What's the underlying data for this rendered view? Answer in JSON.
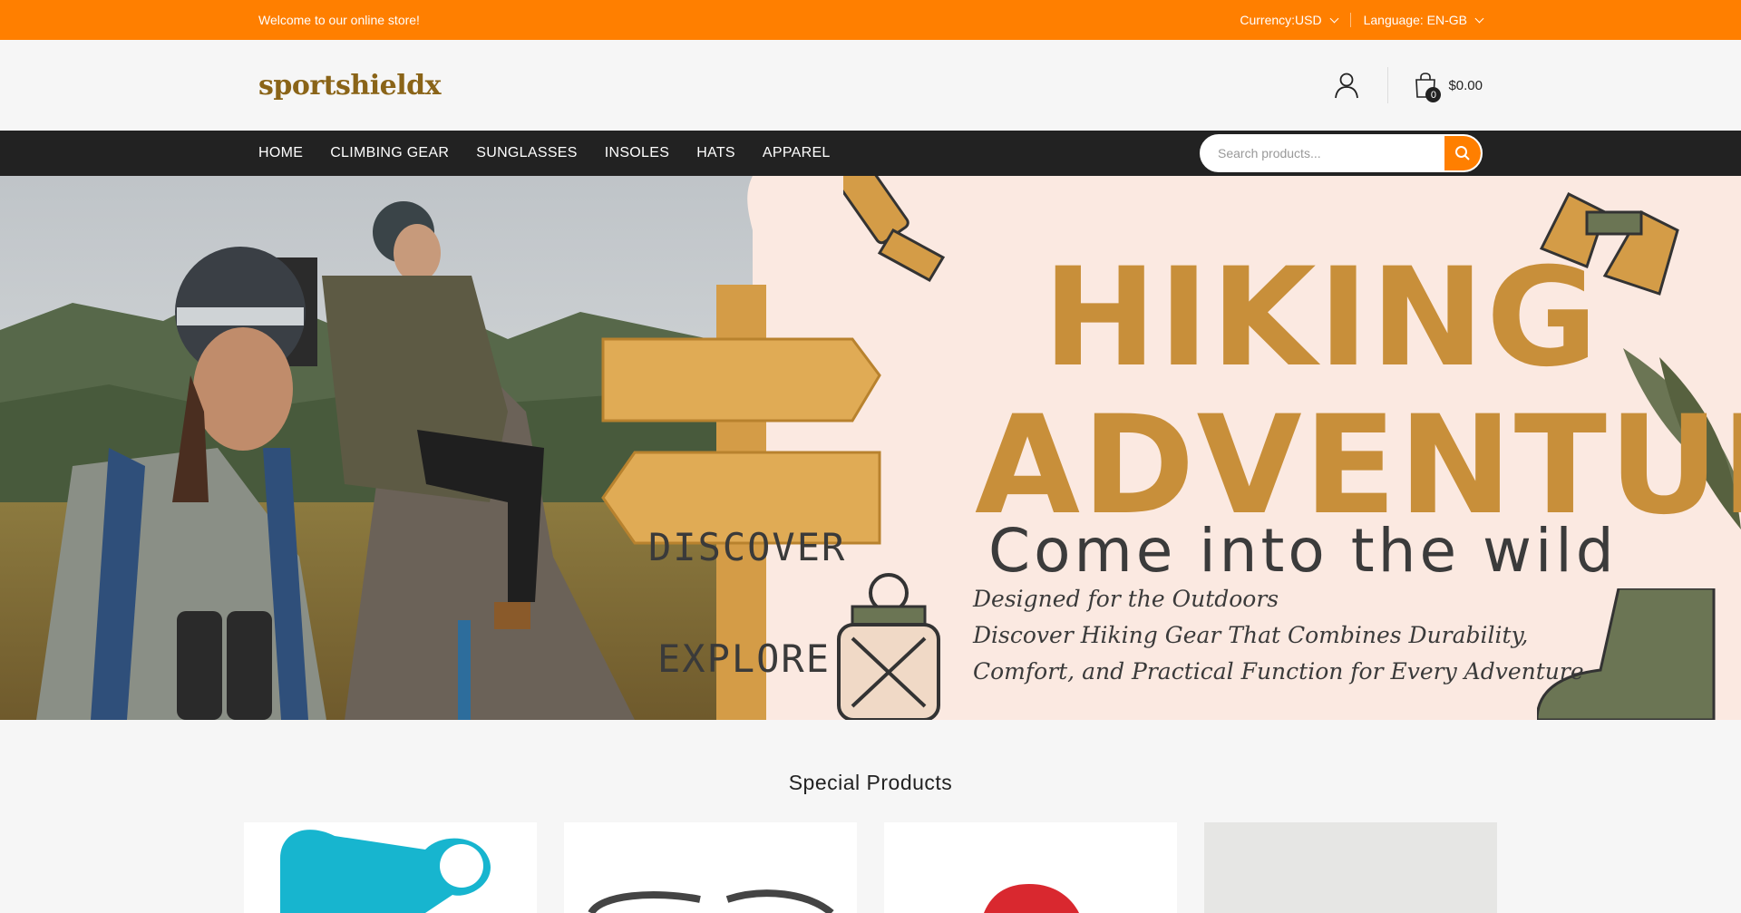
{
  "topbar": {
    "welcome": "Welcome to our online store!",
    "currency": "Currency:USD",
    "language": "Language: EN-GB"
  },
  "header": {
    "logo": "sportshieldx",
    "cart_count": "0",
    "cart_total": "$0.00"
  },
  "nav": {
    "items": [
      "HOME",
      "CLIMBING GEAR",
      "SUNGLASSES",
      "INSOLES",
      "HATS",
      "APPAREL"
    ],
    "search_placeholder": "Search products..."
  },
  "banner": {
    "title_line1": "HIKING",
    "title_line2": "ADVENTURE",
    "subtitle": "Come into the wild",
    "tagline1": "Designed for the Outdoors",
    "tagline2": "Discover Hiking Gear That Combines Durability,",
    "tagline3": "Comfort, and Practical Function for Every Adventure",
    "sign_top": "DISCOVER",
    "sign_bottom": "EXPLORE"
  },
  "special": {
    "title": "Special Products"
  },
  "colors": {
    "accent": "#ff7f00",
    "nav_bg": "#222222",
    "logo": "#8a6418",
    "banner_gold": "#c88f3a",
    "banner_bg": "#fbe9e1"
  }
}
